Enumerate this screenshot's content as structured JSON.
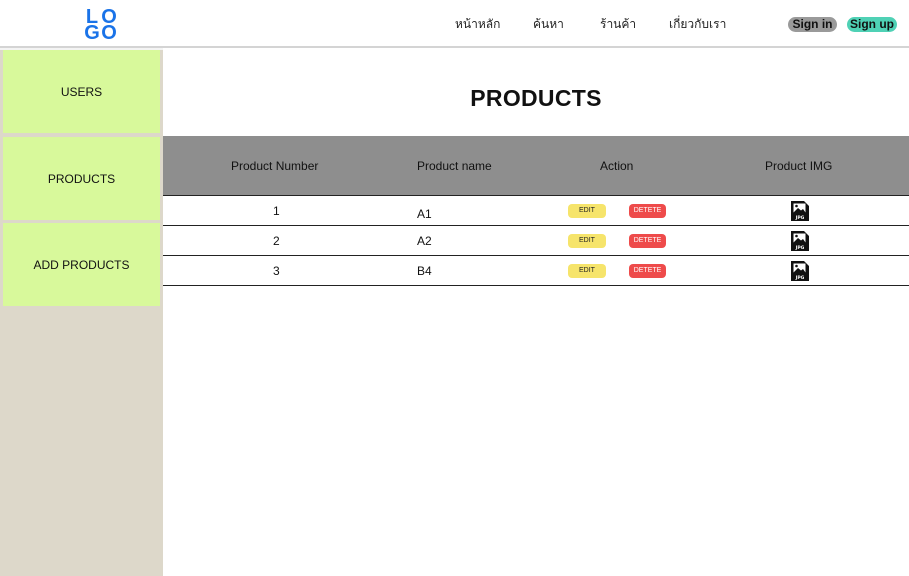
{
  "header": {
    "logo": [
      "L",
      "O",
      "G",
      "O"
    ],
    "nav": [
      "หน้าหลัก",
      "ค้นหา",
      "ร้านค้า",
      "เกี่ยวกับเรา"
    ],
    "signin": "Sign in",
    "signup": "Sign up"
  },
  "sidebar": {
    "items": [
      {
        "label": "USERS"
      },
      {
        "label": "PRODUCTS"
      },
      {
        "label": "ADD PRODUCTS"
      }
    ]
  },
  "main": {
    "title": "PRODUCTS",
    "columns": [
      "Product Number",
      "Product name",
      "Action",
      "Product IMG"
    ],
    "edit_label": "EDIT",
    "delete_label": "DETETE",
    "image_icon": "jpg-file-icon",
    "rows": [
      {
        "number": "1",
        "name": "A1"
      },
      {
        "number": "2",
        "name": "A2"
      },
      {
        "number": "3",
        "name": "B4"
      }
    ]
  },
  "colors": {
    "logo": "#1a73e8",
    "sidebar_item": "#d8f99b",
    "sidebar_bg": "#ddd8ca",
    "table_header": "#8e8e8e",
    "edit_button": "#f6e46b",
    "delete_button": "#ee4b4b",
    "signin": "#9a9a9a",
    "signup": "#4fd1b5"
  }
}
